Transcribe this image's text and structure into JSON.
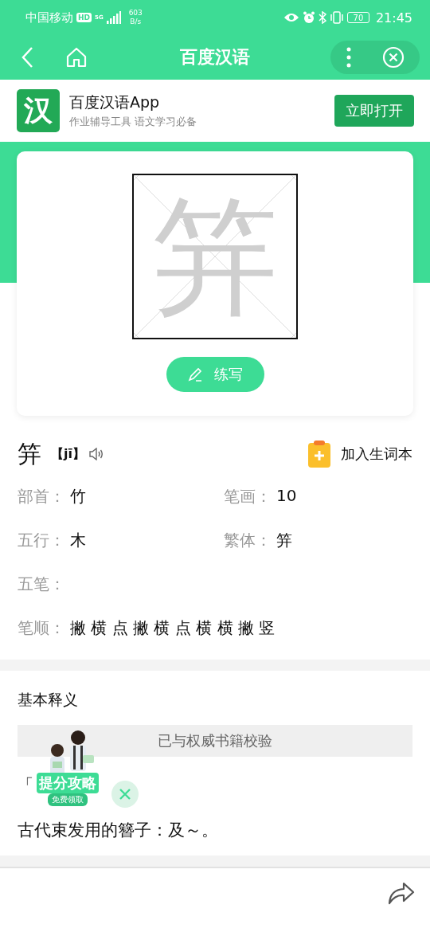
{
  "status_bar": {
    "carrier": "中国移动",
    "network_badge": "HD",
    "network_type": "5G",
    "speed": "603",
    "speed_unit": "B/s",
    "battery": "70",
    "time": "21:45"
  },
  "nav": {
    "title": "百度汉语"
  },
  "app_banner": {
    "icon_glyph": "汉",
    "name": "百度汉语App",
    "tagline": "作业辅导工具 语文学习必备",
    "button": "立即打开"
  },
  "stroke_card": {
    "character": "笄",
    "button": "练写"
  },
  "entry": {
    "character": "笄",
    "pinyin": "【jī】",
    "add_button": "加入生词本",
    "rows": [
      [
        {
          "label": "部首：",
          "value": "竹"
        },
        {
          "label": "笔画：",
          "value": "10"
        }
      ],
      [
        {
          "label": "五行：",
          "value": "木"
        },
        {
          "label": "繁体：",
          "value": "笄"
        }
      ],
      [
        {
          "label": "五笔："
        }
      ],
      [
        {
          "label": "笔顺：",
          "value": "撇 横 点 撇 横 点 横 横 撇 竖"
        }
      ]
    ]
  },
  "meaning": {
    "title": "基本释义",
    "verified": "已与权威书籍校验",
    "bracket": "「",
    "definition": "古代束发用的簪子：及～。"
  },
  "promo": {
    "title": "提分攻略",
    "subtitle": "免费领取"
  }
}
